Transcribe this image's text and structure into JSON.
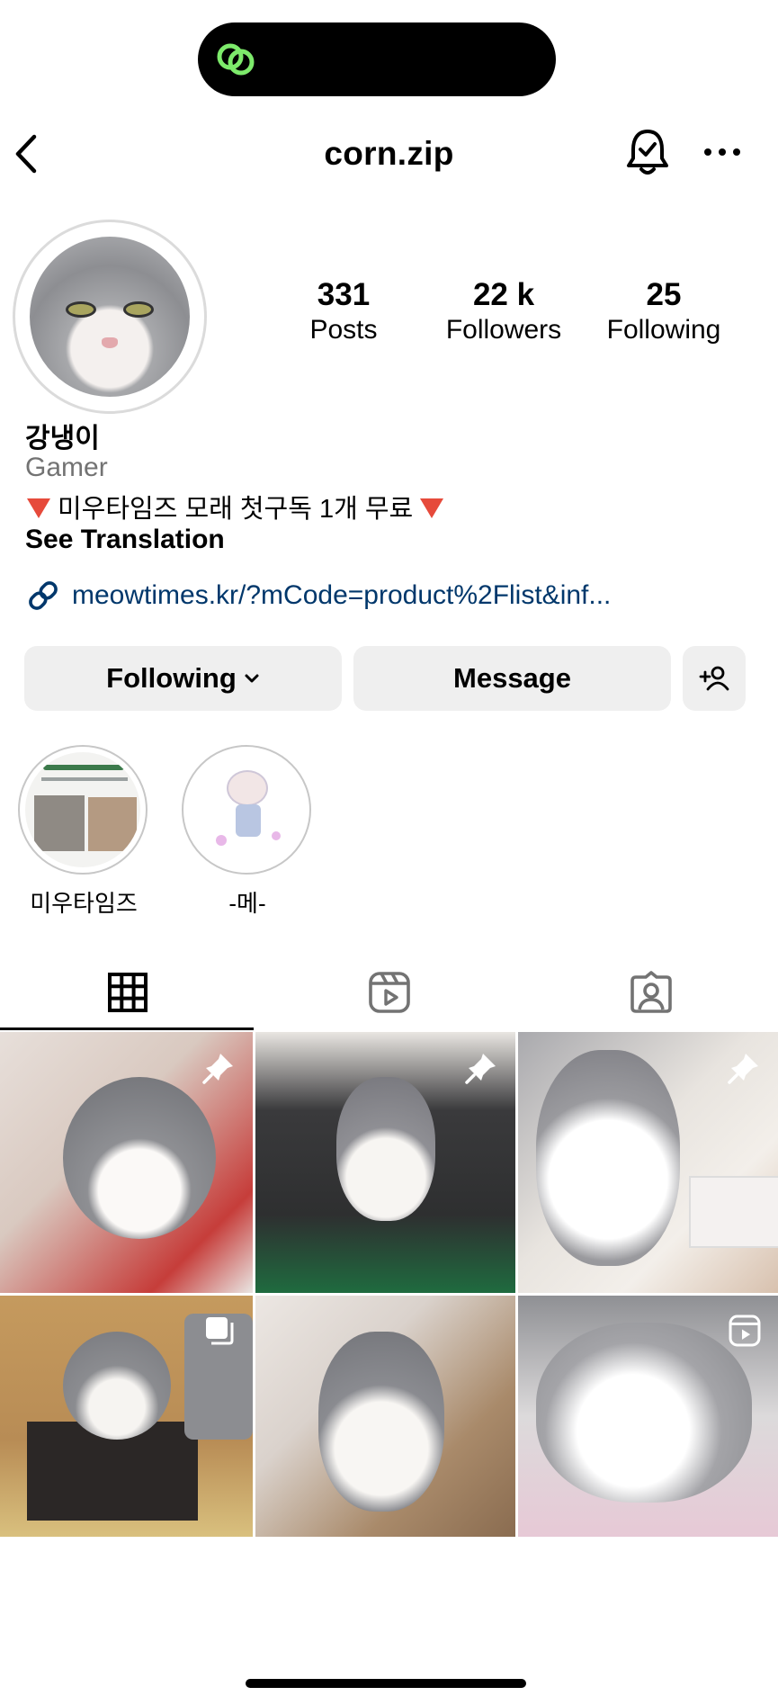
{
  "header": {
    "username": "corn.zip"
  },
  "stats": [
    {
      "value": "331",
      "label": "Posts"
    },
    {
      "value": "22 k",
      "label": "Followers"
    },
    {
      "value": "25",
      "label": "Following"
    }
  ],
  "profile": {
    "display_name": "강냉이",
    "category": "Gamer",
    "bio": "미우타임즈 모래 첫구독 1개 무료",
    "see_translation": "See Translation",
    "link": "meowtimes.kr/?mCode=product%2Flist&inf..."
  },
  "buttons": {
    "following": "Following",
    "message": "Message"
  },
  "highlights": [
    {
      "label": "미우타임즈"
    },
    {
      "label": "-메-"
    }
  ],
  "icons": {
    "back": "chevron-left-icon",
    "bell": "notification-bell-icon",
    "more": "more-horizontal-icon",
    "link": "link-icon",
    "add_person": "add-person-icon",
    "grid_tab": "grid-icon",
    "reels_tab": "reels-icon",
    "tagged_tab": "tagged-icon",
    "pin": "pin-icon",
    "carousel": "carousel-icon"
  },
  "colors": {
    "link": "#00376b",
    "button_bg": "#efefef",
    "secondary_text": "#737373",
    "bio_emoji": "#e64a3b",
    "island_logo": "#7dea6b"
  }
}
